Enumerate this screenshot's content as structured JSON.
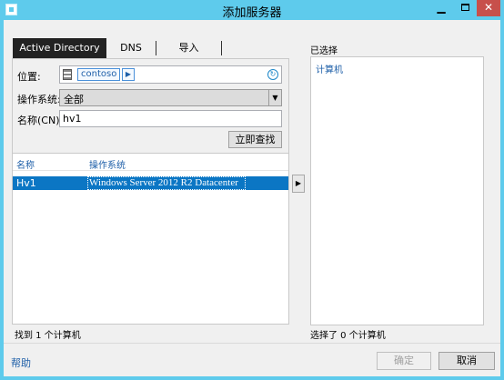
{
  "window": {
    "title": "添加服务器",
    "controls": {
      "minimize": "▁",
      "close": "✕"
    }
  },
  "tabs": [
    {
      "label": "Active Directory",
      "active": true
    },
    {
      "label": "DNS",
      "active": false
    },
    {
      "label": "导入",
      "active": false
    }
  ],
  "search": {
    "location_label": "位置:",
    "location_value": "contoso",
    "location_arrow": "▶",
    "refresh_icon": "↻",
    "os_label": "操作系统:",
    "os_value": "全部",
    "os_arrow": "▼",
    "name_label": "名称(CN):",
    "name_value": "hv1",
    "find_button": "立即查找"
  },
  "results": {
    "columns": [
      "名称",
      "操作系统"
    ],
    "rows": [
      {
        "name": "Hv1",
        "os": "Windows Server 2012 R2 Datacenter",
        "selected": true
      }
    ],
    "status": "找到 1 个计算机"
  },
  "add_button": "▶",
  "selected": {
    "label": "已选择",
    "column": "计算机",
    "status": "选择了 0 个计算机"
  },
  "footer": {
    "help": "帮助",
    "ok": "确定",
    "cancel": "取消"
  },
  "colors": {
    "titlebar": "#5ecbec",
    "close": "#c7504b",
    "selection": "#0b76c4",
    "link": "#1e5fa8"
  }
}
